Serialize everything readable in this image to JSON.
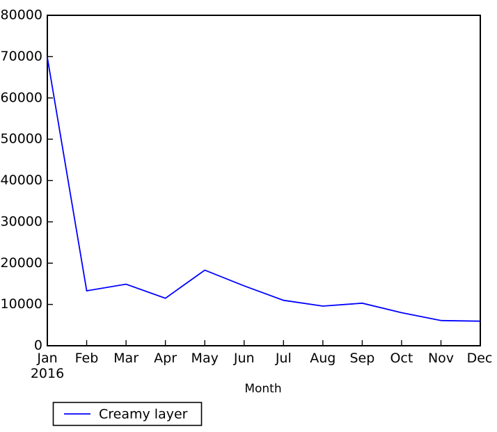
{
  "chart_data": {
    "type": "line",
    "title": "",
    "xlabel": "Month",
    "ylabel": "",
    "categories": [
      "Jan",
      "Feb",
      "Mar",
      "Apr",
      "May",
      "Jun",
      "Jul",
      "Aug",
      "Sep",
      "Oct",
      "Nov",
      "Dec"
    ],
    "x_sub_label": "2016",
    "values": [
      69800,
      13300,
      14900,
      11500,
      18300,
      14500,
      11000,
      9600,
      10300,
      8000,
      6100,
      5950
    ],
    "series": [
      {
        "name": "Creamy layer",
        "color": "#0000ff",
        "values": [
          69800,
          13300,
          14900,
          11500,
          18300,
          14500,
          11000,
          9600,
          10300,
          8000,
          6100,
          5950
        ]
      }
    ],
    "ylim": [
      0,
      80000
    ],
    "xlim": [
      0,
      11
    ],
    "ytick_labels": [
      "0",
      "10000",
      "20000",
      "30000",
      "40000",
      "50000",
      "60000",
      "70000",
      "80000"
    ],
    "ytick_values": [
      0,
      10000,
      20000,
      30000,
      40000,
      50000,
      60000,
      70000,
      80000
    ],
    "grid": false,
    "legend": {
      "position": "below-left",
      "entries": [
        {
          "label": "Creamy layer",
          "color": "#0000ff"
        }
      ]
    },
    "colors": {
      "line": "#0000ff",
      "axis": "#000000",
      "background": "#ffffff"
    }
  }
}
